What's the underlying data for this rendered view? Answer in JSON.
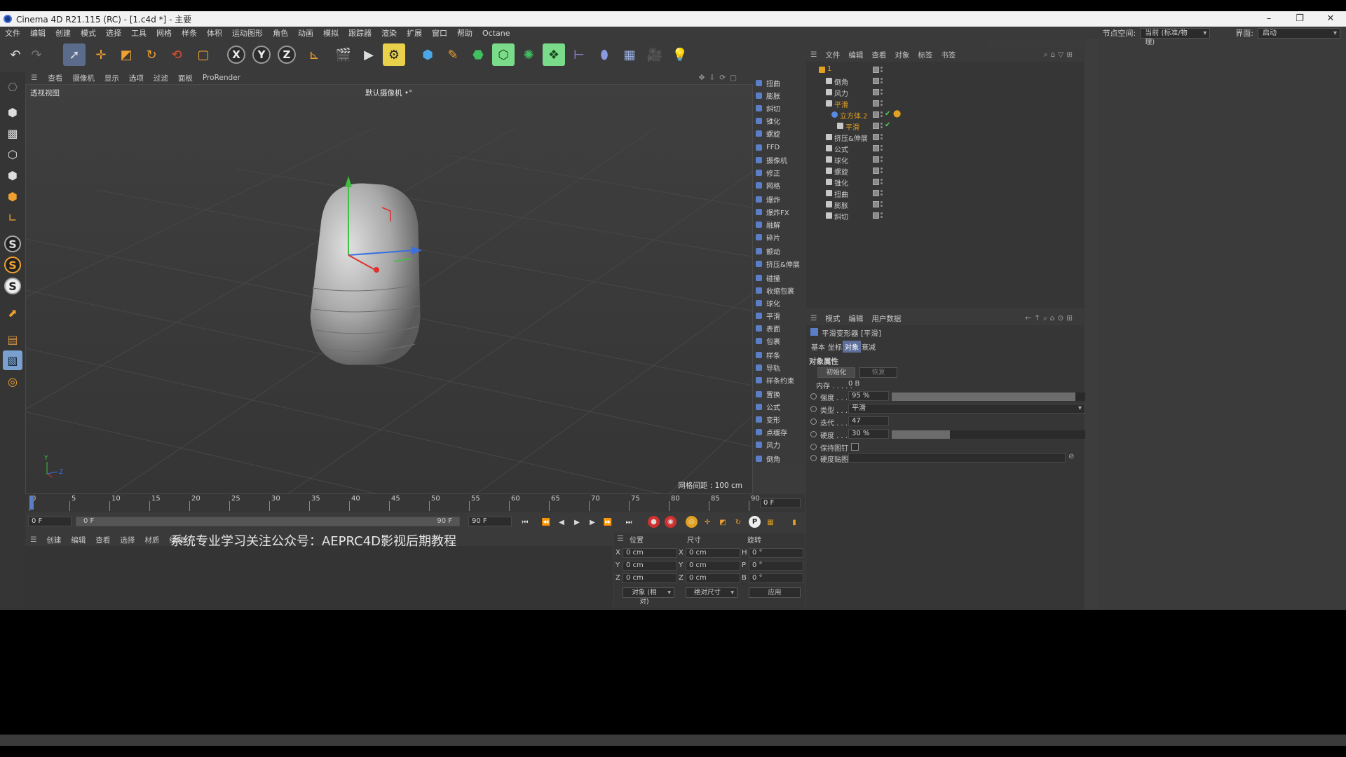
{
  "window": {
    "title": "Cinema 4D R21.115 (RC) - [1.c4d *] - 主要",
    "minimize": "–",
    "restore": "❐",
    "close": "✕"
  },
  "menubar": {
    "items": [
      "文件",
      "编辑",
      "创建",
      "模式",
      "选择",
      "工具",
      "网格",
      "样条",
      "体积",
      "运动图形",
      "角色",
      "动画",
      "模拟",
      "跟踪器",
      "渲染",
      "扩展",
      "窗口",
      "帮助",
      "Octane"
    ],
    "node_space_label": "节点空间:",
    "node_space_value": "当前 (标准/物理)",
    "layout_label": "界面:",
    "layout_value": "启动"
  },
  "toolbar": {
    "axis_x": "X",
    "axis_y": "Y",
    "axis_z": "Z"
  },
  "leftbar": {
    "s1": "S",
    "s2": "S",
    "s3": "S"
  },
  "viewport": {
    "menu": [
      "查看",
      "摄像机",
      "显示",
      "选项",
      "过滤",
      "面板",
      "ProRender"
    ],
    "label": "透视视图",
    "camera": "默认摄像机 •°",
    "grid": "网格间距 : 100 cm"
  },
  "palette": {
    "items": [
      "扭曲",
      "膨胀",
      "斜切",
      "锥化",
      "螺旋",
      "FFD",
      "摄像机",
      "修正",
      "网格",
      "爆炸",
      "爆炸FX",
      "融解",
      "碎片",
      "颤动",
      "挤压&伸展",
      "碰撞",
      "收缩包裹",
      "球化",
      "平滑",
      "表面",
      "包裹",
      "样条",
      "导轨",
      "样条约束",
      "置换",
      "公式",
      "变形",
      "点缓存",
      "风力",
      "倒角"
    ]
  },
  "object_manager": {
    "menu": [
      "文件",
      "编辑",
      "查看",
      "对象",
      "标签",
      "书签"
    ],
    "rows": [
      {
        "name": "1",
        "color": "#e0a020",
        "indent": 0
      },
      {
        "name": "倒角",
        "color": "#c8c8c8",
        "indent": 1
      },
      {
        "name": "风力",
        "color": "#c8c8c8",
        "indent": 1
      },
      {
        "name": "平滑",
        "color": "#e0a020",
        "indent": 1
      },
      {
        "name": "立方体.2",
        "color": "#e0a020",
        "indent": 2
      },
      {
        "name": "平滑",
        "color": "#e0a020",
        "indent": 3
      },
      {
        "name": "挤压&伸展",
        "color": "#c8c8c8",
        "indent": 1
      },
      {
        "name": "公式",
        "color": "#c8c8c8",
        "indent": 1
      },
      {
        "name": "球化",
        "color": "#c8c8c8",
        "indent": 1
      },
      {
        "name": "螺旋",
        "color": "#c8c8c8",
        "indent": 1
      },
      {
        "name": "锥化",
        "color": "#c8c8c8",
        "indent": 1
      },
      {
        "name": "扭曲",
        "color": "#c8c8c8",
        "indent": 1
      },
      {
        "name": "膨胀",
        "color": "#c8c8c8",
        "indent": 1
      },
      {
        "name": "斜切",
        "color": "#c8c8c8",
        "indent": 1
      }
    ]
  },
  "attribute_manager": {
    "menu": [
      "模式",
      "编辑",
      "用户数据"
    ],
    "object_title": "平滑变形器 [平滑]",
    "tabs": [
      "基本",
      "坐标",
      "对象",
      "衰减"
    ],
    "section": "对象属性",
    "init_button": "初始化",
    "restore_button": "恢复",
    "memory_label": "内存 . . . . .",
    "memory_value": "0 B",
    "strength_label": "强度 . . .",
    "strength_value": "95 %",
    "strength_fraction": 0.95,
    "type_label": "类型 . . .",
    "type_value": "平滑",
    "iterations_label": "迭代 . . .",
    "iterations_value": "47",
    "stiffness_label": "硬度 . . .",
    "stiffness_value": "30 %",
    "stiffness_fraction": 0.3,
    "keep_label": "保持图钉",
    "map_label": "硬度贴图"
  },
  "timeline": {
    "ticks": [
      "0",
      "5",
      "10",
      "15",
      "20",
      "25",
      "30",
      "35",
      "40",
      "45",
      "50",
      "55",
      "60",
      "65",
      "70",
      "75",
      "80",
      "85",
      "90"
    ],
    "current_frame": "0 F",
    "start": "0 F",
    "range_start": "0 F",
    "range_end": "90 F",
    "end": "90 F"
  },
  "material_manager": {
    "menu": [
      "创建",
      "编辑",
      "查看",
      "选择",
      "材质",
      "纹理"
    ],
    "watermark": "系统专业学习关注公众号：AEPRC4D影视后期教程"
  },
  "coordinates": {
    "headers": [
      "位置",
      "尺寸",
      "旋转"
    ],
    "axis_x": "X",
    "axis_y": "Y",
    "axis_z": "Z",
    "axis_h": "H",
    "axis_p": "P",
    "axis_b": "B",
    "pos_x": "0 cm",
    "pos_y": "0 cm",
    "pos_z": "0 cm",
    "size_x": "0 cm",
    "size_y": "0 cm",
    "size_z": "0 cm",
    "rot_h": "0 °",
    "rot_p": "0 °",
    "rot_b": "0 °",
    "mode": "对象 (相对)",
    "size_mode": "绝对尺寸",
    "apply": "应用"
  },
  "colors": {
    "accent": "#5d6f9a",
    "panel": "#363636",
    "orange": "#e0a020",
    "green_check": "#4fcf4f"
  }
}
